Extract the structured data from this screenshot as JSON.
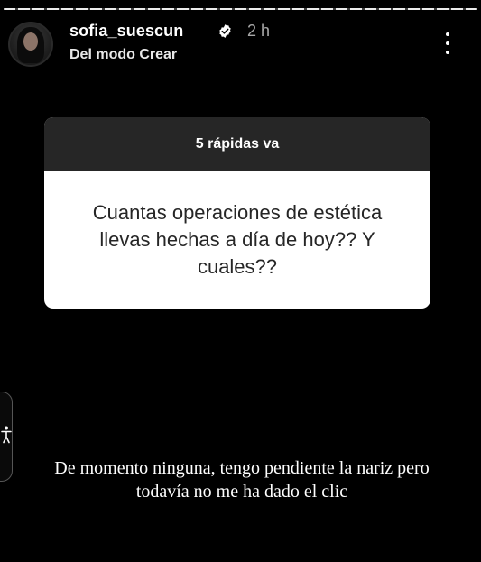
{
  "story": {
    "progress": 1.0
  },
  "header": {
    "username": "sofia_suescun",
    "verified_icon": "verified-badge-icon",
    "time": "2 h",
    "subtitle": "Del modo Crear",
    "more_icon": "more-vertical-icon"
  },
  "question_card": {
    "title": "5 rápidas va",
    "question": "Cuantas operaciones de estética llevas hechas a día de hoy?? Y cuales??"
  },
  "side_tab": {
    "icon": "accessibility-icon"
  },
  "answer": {
    "text": "De momento ninguna, tengo pendiente la nariz pero todavía no me ha dado el clic"
  },
  "colors": {
    "background": "#000000",
    "card_header": "#262626",
    "card_body": "#ffffff",
    "card_text": "#262626",
    "time": "#a8a8a8"
  }
}
